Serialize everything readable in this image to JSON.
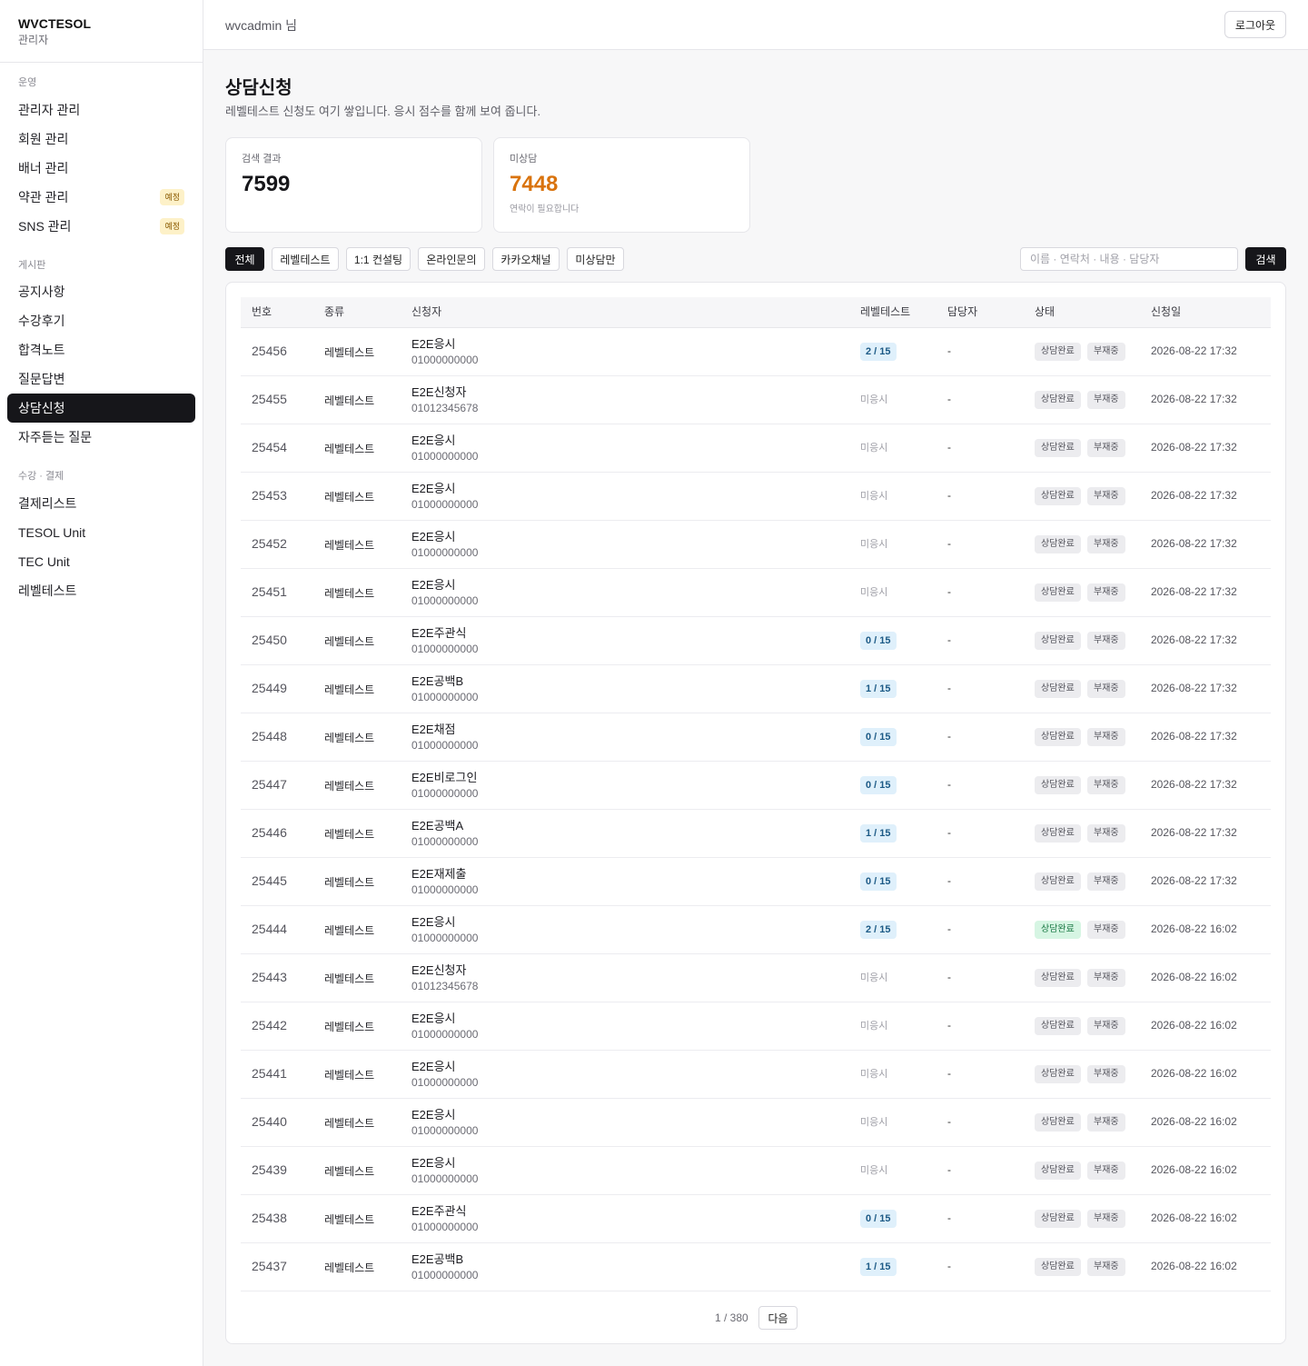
{
  "brand": {
    "name": "WVCTESOL",
    "sub": "관리자"
  },
  "header": {
    "user": "wvcadmin 님",
    "logout": "로그아웃"
  },
  "sidebar": {
    "sections": [
      {
        "title": "운영",
        "items": [
          {
            "label": "관리자 관리",
            "badge": ""
          },
          {
            "label": "회원 관리",
            "badge": ""
          },
          {
            "label": "배너 관리",
            "badge": ""
          },
          {
            "label": "약관 관리",
            "badge": "예정"
          },
          {
            "label": "SNS 관리",
            "badge": "예정"
          }
        ]
      },
      {
        "title": "게시판",
        "items": [
          {
            "label": "공지사항",
            "badge": ""
          },
          {
            "label": "수강후기",
            "badge": ""
          },
          {
            "label": "합격노트",
            "badge": ""
          },
          {
            "label": "질문답변",
            "badge": ""
          },
          {
            "label": "상담신청",
            "badge": "",
            "active": true
          },
          {
            "label": "자주듣는 질문",
            "badge": ""
          }
        ]
      },
      {
        "title": "수강 · 결제",
        "items": [
          {
            "label": "결제리스트",
            "badge": ""
          },
          {
            "label": "TESOL Unit",
            "badge": ""
          },
          {
            "label": "TEC Unit",
            "badge": ""
          },
          {
            "label": "레벨테스트",
            "badge": ""
          }
        ]
      }
    ]
  },
  "page": {
    "title": "상담신청",
    "description": "레벨테스트 신청도 여기 쌓입니다. 응시 점수를 함께 보여 줍니다."
  },
  "stats": {
    "results": {
      "label": "검색 결과",
      "value": "7599"
    },
    "pending": {
      "label": "미상담",
      "value": "7448",
      "note": "연락이 필요합니다"
    }
  },
  "filters": [
    "전체",
    "레벨테스트",
    "1:1 컨설팅",
    "온라인문의",
    "카카오채널",
    "미상담만"
  ],
  "search": {
    "placeholder": "이름 · 연락처 · 내용 · 담당자",
    "button": "검색"
  },
  "table": {
    "headers": [
      "번호",
      "종류",
      "신청자",
      "레벨테스트",
      "담당자",
      "상태",
      "신청일"
    ],
    "rows": [
      {
        "num": "25456",
        "type": "레벨테스트",
        "name": "E2E응시",
        "phone": "01000000000",
        "score": "2 / 15",
        "manager": "-",
        "status": "상담완료",
        "done": false,
        "absent": "부재중",
        "date": "2026-08-22 17:32"
      },
      {
        "num": "25455",
        "type": "레벨테스트",
        "name": "E2E신청자",
        "phone": "01012345678",
        "score": "미응시",
        "manager": "-",
        "status": "상담완료",
        "done": false,
        "absent": "부재중",
        "date": "2026-08-22 17:32"
      },
      {
        "num": "25454",
        "type": "레벨테스트",
        "name": "E2E응시",
        "phone": "01000000000",
        "score": "미응시",
        "manager": "-",
        "status": "상담완료",
        "done": false,
        "absent": "부재중",
        "date": "2026-08-22 17:32"
      },
      {
        "num": "25453",
        "type": "레벨테스트",
        "name": "E2E응시",
        "phone": "01000000000",
        "score": "미응시",
        "manager": "-",
        "status": "상담완료",
        "done": false,
        "absent": "부재중",
        "date": "2026-08-22 17:32"
      },
      {
        "num": "25452",
        "type": "레벨테스트",
        "name": "E2E응시",
        "phone": "01000000000",
        "score": "미응시",
        "manager": "-",
        "status": "상담완료",
        "done": false,
        "absent": "부재중",
        "date": "2026-08-22 17:32"
      },
      {
        "num": "25451",
        "type": "레벨테스트",
        "name": "E2E응시",
        "phone": "01000000000",
        "score": "미응시",
        "manager": "-",
        "status": "상담완료",
        "done": false,
        "absent": "부재중",
        "date": "2026-08-22 17:32"
      },
      {
        "num": "25450",
        "type": "레벨테스트",
        "name": "E2E주관식",
        "phone": "01000000000",
        "score": "0 / 15",
        "manager": "-",
        "status": "상담완료",
        "done": false,
        "absent": "부재중",
        "date": "2026-08-22 17:32"
      },
      {
        "num": "25449",
        "type": "레벨테스트",
        "name": "E2E공백B",
        "phone": "01000000000",
        "score": "1 / 15",
        "manager": "-",
        "status": "상담완료",
        "done": false,
        "absent": "부재중",
        "date": "2026-08-22 17:32"
      },
      {
        "num": "25448",
        "type": "레벨테스트",
        "name": "E2E채점",
        "phone": "01000000000",
        "score": "0 / 15",
        "manager": "-",
        "status": "상담완료",
        "done": false,
        "absent": "부재중",
        "date": "2026-08-22 17:32"
      },
      {
        "num": "25447",
        "type": "레벨테스트",
        "name": "E2E비로그인",
        "phone": "01000000000",
        "score": "0 / 15",
        "manager": "-",
        "status": "상담완료",
        "done": false,
        "absent": "부재중",
        "date": "2026-08-22 17:32"
      },
      {
        "num": "25446",
        "type": "레벨테스트",
        "name": "E2E공백A",
        "phone": "01000000000",
        "score": "1 / 15",
        "manager": "-",
        "status": "상담완료",
        "done": false,
        "absent": "부재중",
        "date": "2026-08-22 17:32"
      },
      {
        "num": "25445",
        "type": "레벨테스트",
        "name": "E2E재제출",
        "phone": "01000000000",
        "score": "0 / 15",
        "manager": "-",
        "status": "상담완료",
        "done": false,
        "absent": "부재중",
        "date": "2026-08-22 17:32"
      },
      {
        "num": "25444",
        "type": "레벨테스트",
        "name": "E2E응시",
        "phone": "01000000000",
        "score": "2 / 15",
        "manager": "-",
        "status": "상담완료",
        "done": true,
        "absent": "부재중",
        "date": "2026-08-22 16:02"
      },
      {
        "num": "25443",
        "type": "레벨테스트",
        "name": "E2E신청자",
        "phone": "01012345678",
        "score": "미응시",
        "manager": "-",
        "status": "상담완료",
        "done": false,
        "absent": "부재중",
        "date": "2026-08-22 16:02"
      },
      {
        "num": "25442",
        "type": "레벨테스트",
        "name": "E2E응시",
        "phone": "01000000000",
        "score": "미응시",
        "manager": "-",
        "status": "상담완료",
        "done": false,
        "absent": "부재중",
        "date": "2026-08-22 16:02"
      },
      {
        "num": "25441",
        "type": "레벨테스트",
        "name": "E2E응시",
        "phone": "01000000000",
        "score": "미응시",
        "manager": "-",
        "status": "상담완료",
        "done": false,
        "absent": "부재중",
        "date": "2026-08-22 16:02"
      },
      {
        "num": "25440",
        "type": "레벨테스트",
        "name": "E2E응시",
        "phone": "01000000000",
        "score": "미응시",
        "manager": "-",
        "status": "상담완료",
        "done": false,
        "absent": "부재중",
        "date": "2026-08-22 16:02"
      },
      {
        "num": "25439",
        "type": "레벨테스트",
        "name": "E2E응시",
        "phone": "01000000000",
        "score": "미응시",
        "manager": "-",
        "status": "상담완료",
        "done": false,
        "absent": "부재중",
        "date": "2026-08-22 16:02"
      },
      {
        "num": "25438",
        "type": "레벨테스트",
        "name": "E2E주관식",
        "phone": "01000000000",
        "score": "0 / 15",
        "manager": "-",
        "status": "상담완료",
        "done": false,
        "absent": "부재중",
        "date": "2026-08-22 16:02"
      },
      {
        "num": "25437",
        "type": "레벨테스트",
        "name": "E2E공백B",
        "phone": "01000000000",
        "score": "1 / 15",
        "manager": "-",
        "status": "상담완료",
        "done": false,
        "absent": "부재중",
        "date": "2026-08-22 16:02"
      }
    ]
  },
  "pagination": {
    "info": "1 / 380",
    "next": "다음"
  }
}
